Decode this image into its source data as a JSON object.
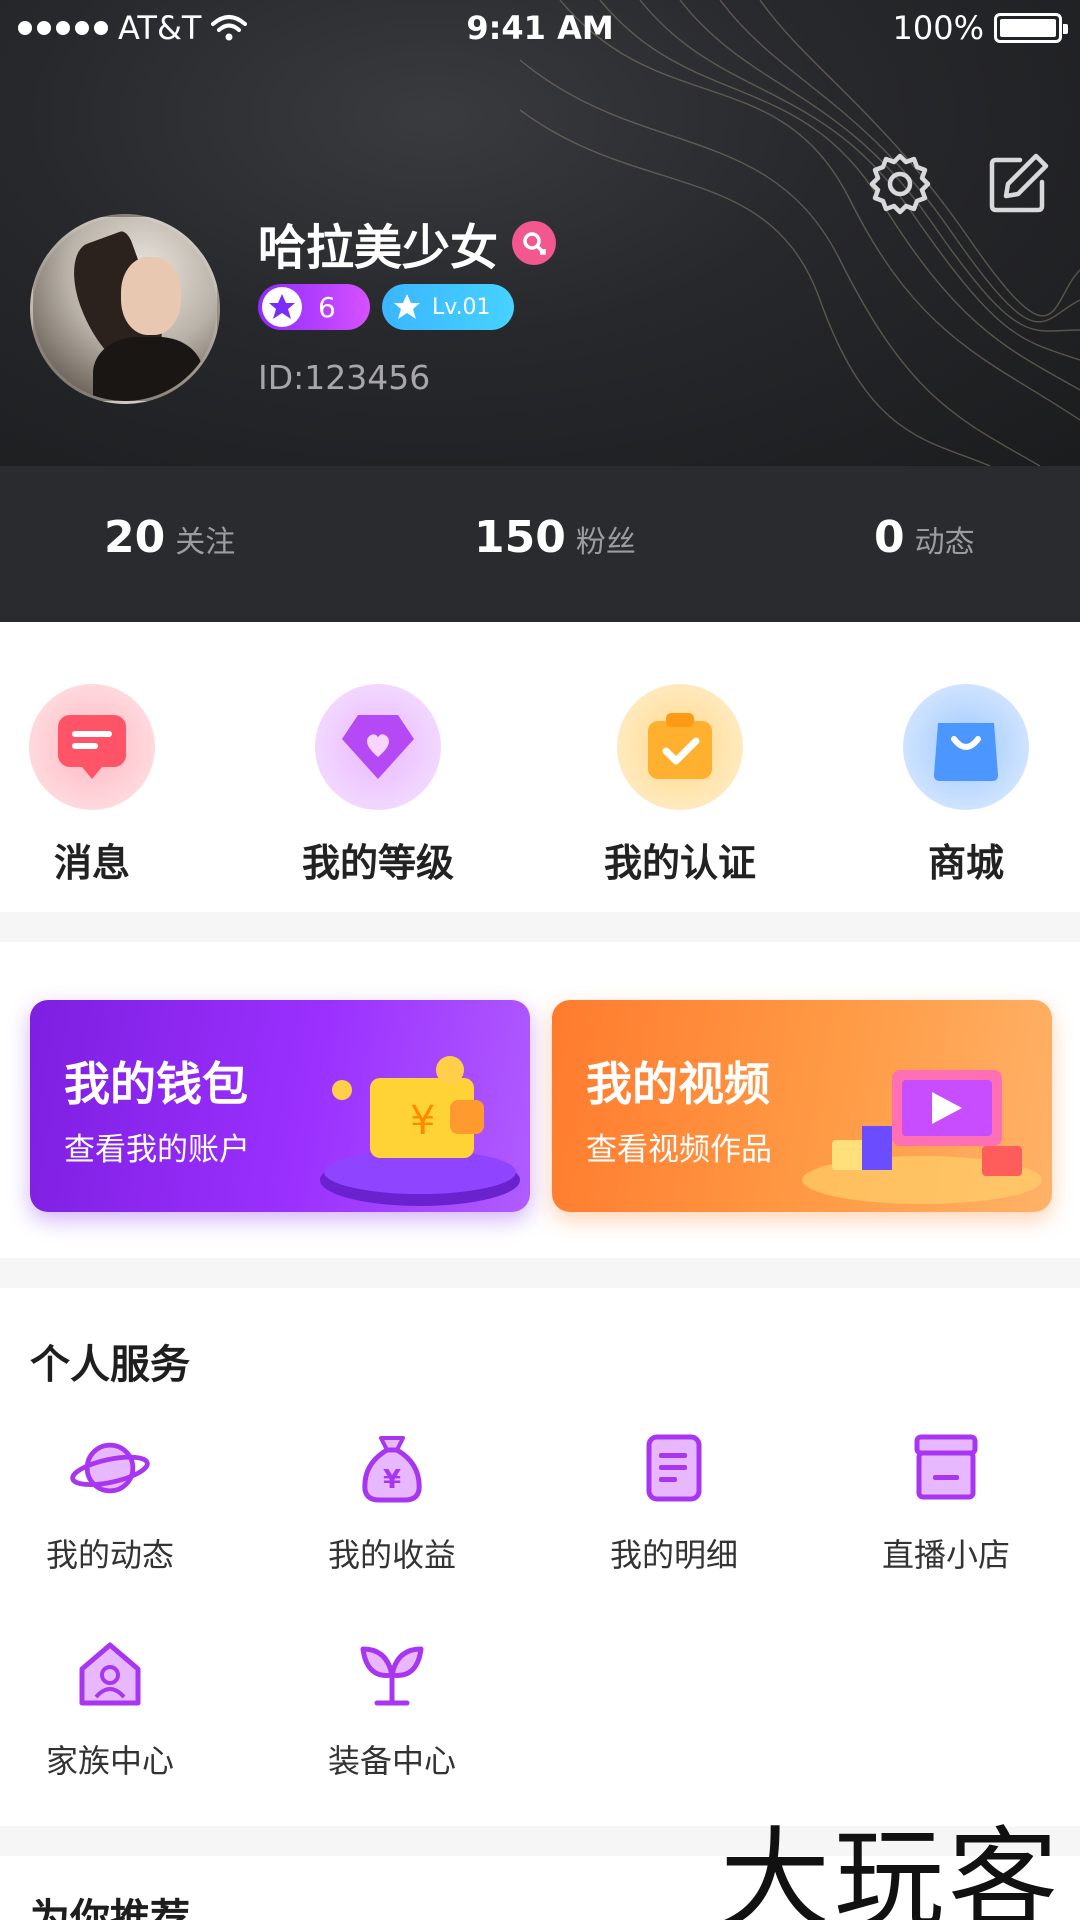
{
  "status_bar": {
    "carrier": "AT&T",
    "time": "9:41 AM",
    "battery": "100%"
  },
  "profile": {
    "name": "哈拉美少女",
    "level_count": "6",
    "level_badge": "Lv.01",
    "id_text": "ID:123456"
  },
  "stats": [
    {
      "value": "20",
      "label": "关注"
    },
    {
      "value": "150",
      "label": "粉丝"
    },
    {
      "value": "0",
      "label": "动态"
    }
  ],
  "quick_menu": [
    {
      "label": "消息",
      "icon": "message-icon"
    },
    {
      "label": "我的等级",
      "icon": "level-icon"
    },
    {
      "label": "我的认证",
      "icon": "verify-icon"
    },
    {
      "label": "商城",
      "icon": "shop-icon"
    }
  ],
  "banners": {
    "wallet": {
      "title": "我的钱包",
      "subtitle": "查看我的账户"
    },
    "video": {
      "title": "我的视频",
      "subtitle": "查看视频作品"
    }
  },
  "services": {
    "title": "个人服务",
    "items": [
      {
        "label": "我的动态",
        "icon": "planet-icon"
      },
      {
        "label": "我的收益",
        "icon": "money-bag-icon"
      },
      {
        "label": "我的明细",
        "icon": "document-icon"
      },
      {
        "label": "直播小店",
        "icon": "store-icon"
      },
      {
        "label": "家族中心",
        "icon": "home-icon"
      },
      {
        "label": "装备中心",
        "icon": "sprout-icon"
      }
    ]
  },
  "recommend": {
    "title": "为你推荐"
  },
  "watermark": "大玩客",
  "colors": {
    "accent_purple": "#a838f0",
    "header_dark": "#27282b"
  }
}
